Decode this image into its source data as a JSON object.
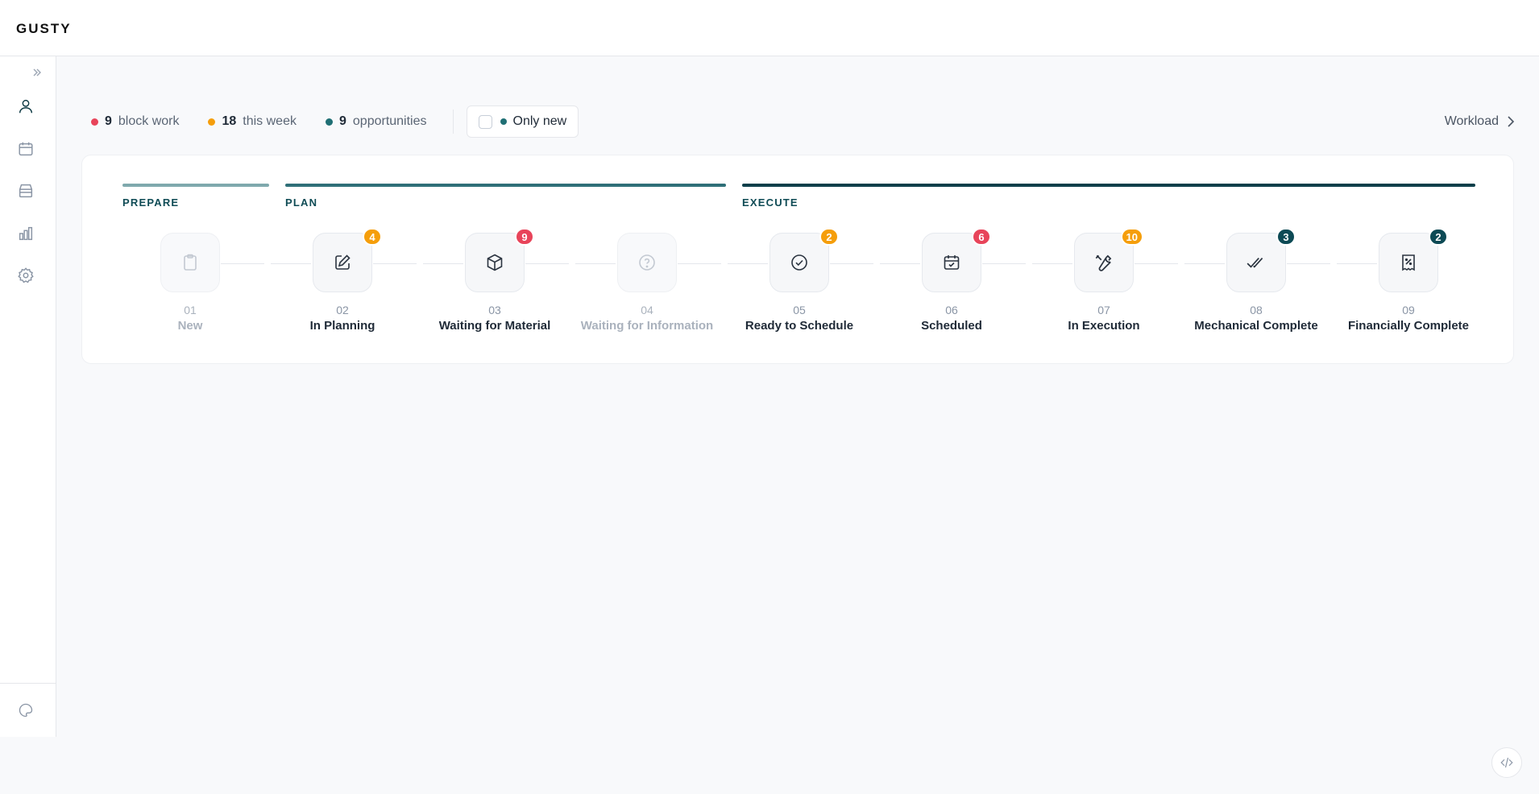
{
  "brand": {
    "name": "GUSTY"
  },
  "sidebar": {
    "items": [
      {
        "icon": "user-icon",
        "active": true
      },
      {
        "icon": "calendar-icon",
        "active": false
      },
      {
        "icon": "inbox-stack-icon",
        "active": false
      },
      {
        "icon": "bar-chart-icon",
        "active": false
      },
      {
        "icon": "gear-icon",
        "active": false
      }
    ],
    "bottom_icon": "palette-icon"
  },
  "filters": {
    "stats": [
      {
        "count": "9",
        "label": "block work",
        "color": "#e8445a"
      },
      {
        "count": "18",
        "label": "this week",
        "color": "#f59e0b"
      },
      {
        "count": "9",
        "label": "opportunities",
        "color": "#1f6f74"
      }
    ],
    "only_new": {
      "label": "Only new",
      "color": "#1f6f74",
      "checked": false
    }
  },
  "workload": {
    "label": "Workload"
  },
  "phases": [
    {
      "label": "PREPARE",
      "color": "#7fa9ad"
    },
    {
      "label": "PLAN",
      "color": "#2f6f78"
    },
    {
      "label": "EXECUTE",
      "color": "#0d3f4a"
    }
  ],
  "steps": [
    {
      "num": "01",
      "name": "New",
      "icon": "clipboard-icon",
      "badge": "",
      "badge_color": "",
      "muted": true
    },
    {
      "num": "02",
      "name": "In Planning",
      "icon": "edit-icon",
      "badge": "4",
      "badge_color": "#f59e0b",
      "muted": false
    },
    {
      "num": "03",
      "name": "Waiting for Material",
      "icon": "box-icon",
      "badge": "9",
      "badge_color": "#e8445a",
      "muted": false
    },
    {
      "num": "04",
      "name": "Waiting for Information",
      "icon": "question-icon",
      "badge": "",
      "badge_color": "",
      "muted": true
    },
    {
      "num": "05",
      "name": "Ready to Schedule",
      "icon": "check-circle-icon",
      "badge": "2",
      "badge_color": "#f59e0b",
      "muted": false
    },
    {
      "num": "06",
      "name": "Scheduled",
      "icon": "calendar-check-icon",
      "badge": "6",
      "badge_color": "#e8445a",
      "muted": false
    },
    {
      "num": "07",
      "name": "In Execution",
      "icon": "wrench-icon",
      "badge": "10",
      "badge_color": "#f59e0b",
      "muted": false
    },
    {
      "num": "08",
      "name": "Mechanical Complete",
      "icon": "double-check-icon",
      "badge": "3",
      "badge_color": "#0d4a55",
      "muted": false
    },
    {
      "num": "09",
      "name": "Financially Complete",
      "icon": "receipt-icon",
      "badge": "2",
      "badge_color": "#0d4a55",
      "muted": false
    }
  ]
}
